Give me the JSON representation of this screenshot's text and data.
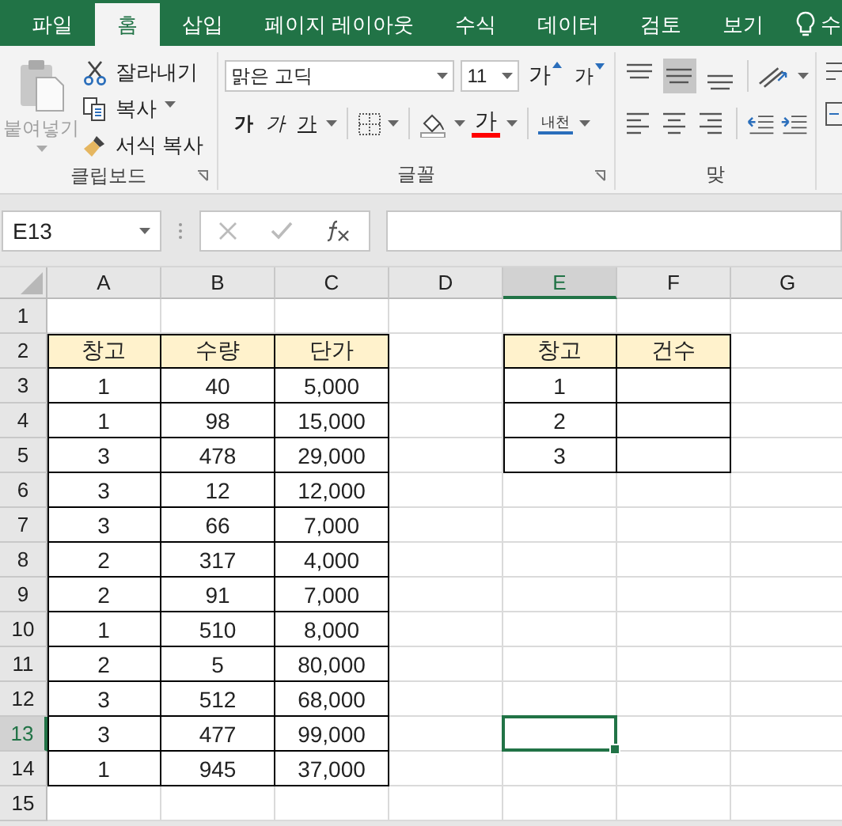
{
  "tabs": [
    {
      "label": "파일",
      "selected": false
    },
    {
      "label": "홈",
      "selected": true
    },
    {
      "label": "삽입",
      "selected": false
    },
    {
      "label": "페이지 레이아웃",
      "selected": false
    },
    {
      "label": "수식",
      "selected": false
    },
    {
      "label": "데이터",
      "selected": false
    },
    {
      "label": "검토",
      "selected": false
    },
    {
      "label": "보기",
      "selected": false
    }
  ],
  "tell_me": {
    "label": "수"
  },
  "clipboard": {
    "paste": {
      "label": "붙여넣기",
      "disabled": true
    },
    "cut": "잘라내기",
    "copy": "복사",
    "format_painter": "서식 복사",
    "label": "클립보드"
  },
  "font": {
    "name": "맑은 고딕",
    "size": "11",
    "grow": "가",
    "shrink": "가",
    "bold": "가",
    "italic": "가",
    "underline": "가",
    "font_color": "가",
    "phonetic": "내천",
    "label": "글꼴"
  },
  "alignment": {
    "vertical": [
      {
        "kind": "top",
        "selected": false
      },
      {
        "kind": "middle",
        "selected": true
      },
      {
        "kind": "bottom",
        "selected": false
      }
    ],
    "horizontal": [
      {
        "kind": "left",
        "selected": false
      },
      {
        "kind": "center",
        "selected": false
      },
      {
        "kind": "right",
        "selected": false
      }
    ],
    "label": "맞"
  },
  "name_box": "E13",
  "columns": [
    {
      "label": "A",
      "selected": false
    },
    {
      "label": "B",
      "selected": false
    },
    {
      "label": "C",
      "selected": false
    },
    {
      "label": "D",
      "selected": false
    },
    {
      "label": "E",
      "selected": true
    },
    {
      "label": "F",
      "selected": false
    },
    {
      "label": "G",
      "selected": false
    }
  ],
  "rows": [
    {
      "label": "1",
      "selected": false
    },
    {
      "label": "2",
      "selected": false
    },
    {
      "label": "3",
      "selected": false
    },
    {
      "label": "4",
      "selected": false
    },
    {
      "label": "5",
      "selected": false
    },
    {
      "label": "6",
      "selected": false
    },
    {
      "label": "7",
      "selected": false
    },
    {
      "label": "8",
      "selected": false
    },
    {
      "label": "9",
      "selected": false
    },
    {
      "label": "10",
      "selected": false
    },
    {
      "label": "11",
      "selected": false
    },
    {
      "label": "12",
      "selected": false
    },
    {
      "label": "13",
      "selected": true
    },
    {
      "label": "14",
      "selected": false
    },
    {
      "label": "15",
      "selected": false
    }
  ],
  "tables": [
    {
      "header": [
        "창고",
        "수량",
        "단가"
      ],
      "rows": [
        [
          "1",
          "40",
          "5,000"
        ],
        [
          "1",
          "98",
          "15,000"
        ],
        [
          "3",
          "478",
          "29,000"
        ],
        [
          "3",
          "12",
          "12,000"
        ],
        [
          "3",
          "66",
          "7,000"
        ],
        [
          "2",
          "317",
          "4,000"
        ],
        [
          "2",
          "91",
          "7,000"
        ],
        [
          "1",
          "510",
          "8,000"
        ],
        [
          "2",
          "5",
          "80,000"
        ],
        [
          "3",
          "512",
          "68,000"
        ],
        [
          "3",
          "477",
          "99,000"
        ],
        [
          "1",
          "945",
          "37,000"
        ]
      ]
    },
    {
      "header": [
        "창고",
        "건수"
      ],
      "rows": [
        [
          "1"
        ],
        [
          "2"
        ],
        [
          "3"
        ]
      ]
    }
  ]
}
